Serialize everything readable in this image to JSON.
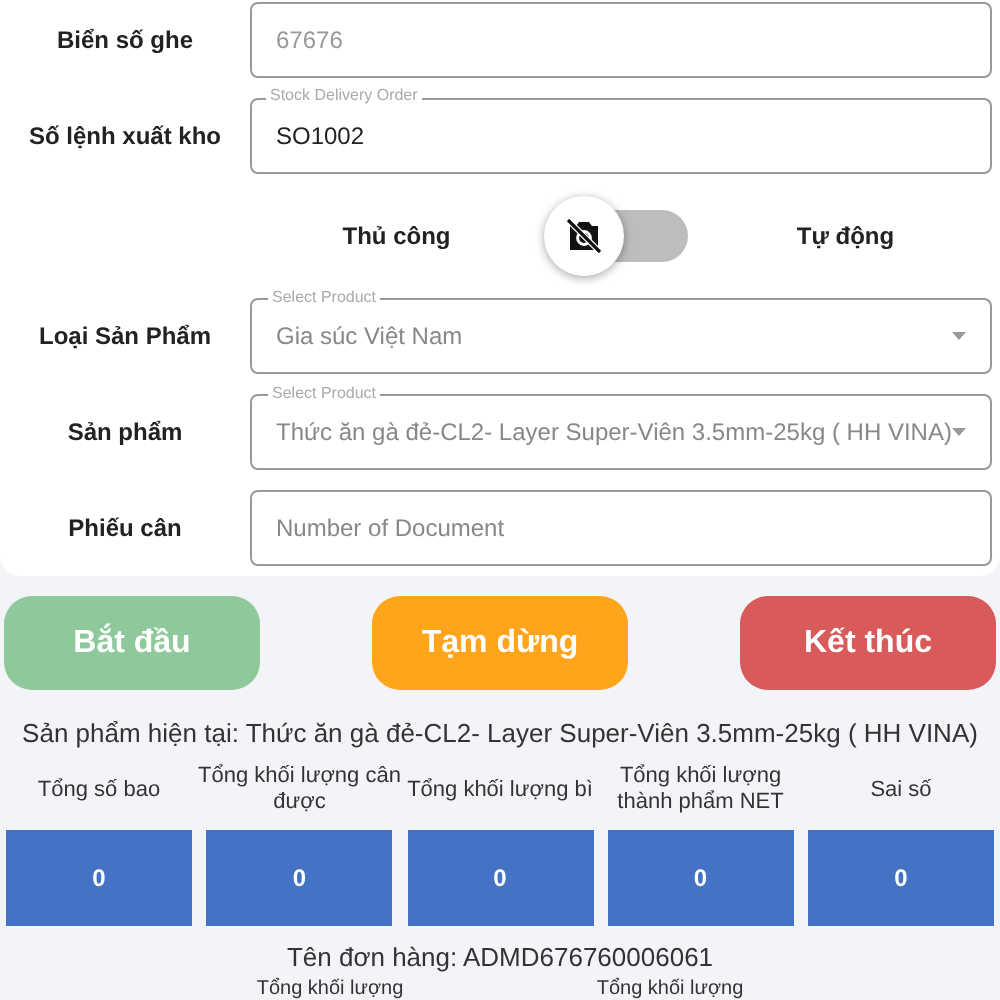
{
  "form": {
    "fields": [
      {
        "kind": "input",
        "label": "Biển số ghe",
        "value": "67676",
        "disabled": true
      },
      {
        "kind": "input",
        "label": "Số lệnh xuất kho",
        "legend": "Stock Delivery Order",
        "value": "SO1002",
        "disabled": false
      },
      {
        "kind": "toggle",
        "left_label": "Thủ công",
        "right_label": "Tự động",
        "on": false
      },
      {
        "kind": "select",
        "label": "Loại Sản Phẩm",
        "legend": "Select Product",
        "value": "Gia súc Việt Nam",
        "disabled": true
      },
      {
        "kind": "select",
        "label": "Sản phẩm",
        "legend": "Select Product",
        "value": "Thức ăn gà đẻ-CL2- Layer Super-Viên 3.5mm-25kg ( HH VINA)",
        "disabled": true
      },
      {
        "kind": "input",
        "label": "Phiếu cân",
        "placeholder": "Number of Document"
      }
    ]
  },
  "actions": [
    {
      "label": "Bắt đầu",
      "color": "#8fc99b"
    },
    {
      "label": "Tạm dừng",
      "color": "#ffa41b"
    },
    {
      "label": "Kết thúc",
      "color": "#d95a5b"
    }
  ],
  "current_product": "Sản phẩm hiện tại:  Thức ăn gà đẻ-CL2- Layer Super-Viên 3.5mm-25kg ( HH VINA)",
  "stats": [
    {
      "label": "Tổng số bao",
      "value": "0"
    },
    {
      "label": "Tổng khối lượng cân được",
      "value": "0"
    },
    {
      "label": "Tổng khối lượng bì",
      "value": "0"
    },
    {
      "label": "Tổng khối lượng thành phẩm NET",
      "value": "0"
    },
    {
      "label": "Sai số",
      "value": "0"
    }
  ],
  "order_name": "Tên đơn hàng:  ADMD676760006061",
  "more_labels": [
    "Tổng khối lượng",
    "Tổng khối lượng"
  ]
}
